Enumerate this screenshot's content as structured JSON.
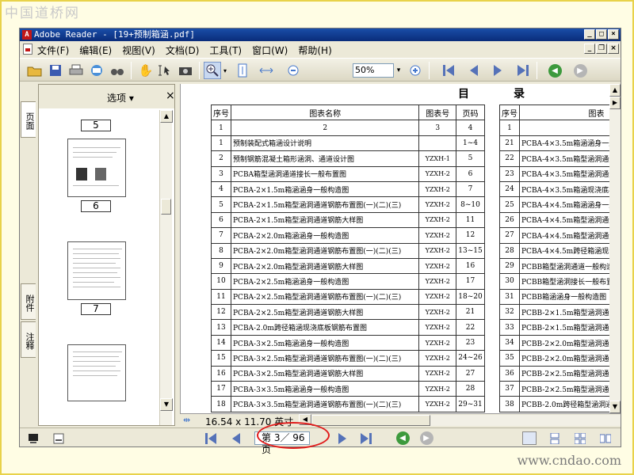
{
  "watermarks": {
    "top": "中国道桥网",
    "bottom": "www.cndao.com"
  },
  "window": {
    "title": "Adobe Reader - [19+预制箱涵.pdf]"
  },
  "menu": [
    "文件(F)",
    "编辑(E)",
    "视图(V)",
    "文档(D)",
    "工具(T)",
    "窗口(W)",
    "帮助(H)"
  ],
  "toolbar": {
    "zoom_value": "50%"
  },
  "side_tabs": [
    "页面",
    "附件",
    "注释"
  ],
  "panel": {
    "options_label": "选项 ▾",
    "thumbnails": [
      {
        "page": "5"
      },
      {
        "page": "6"
      },
      {
        "page": "7"
      }
    ]
  },
  "document": {
    "title_left": "目",
    "title_right": "录",
    "headers": [
      "序号",
      "图表名称",
      "图表号",
      "页码"
    ],
    "number_row": [
      "1",
      "2",
      "3",
      "4"
    ],
    "left_rows": [
      [
        "1",
        "预制装配式箱涵设计说明",
        "",
        "1~4"
      ],
      [
        "2",
        "预制钢筋混凝土箱形涵洞、通道设计图",
        "YZXH-1",
        "5"
      ],
      [
        "3",
        "PCBA箱型涵洞通道接长一般布置图",
        "YZXH-2",
        "6"
      ],
      [
        "4",
        "PCBA-2×1.5m箱涵涵身一般构造图",
        "YZXH-2",
        "7"
      ],
      [
        "5",
        "PCBA-2×1.5m箱型涵洞通道钢筋布置图(一)(二)(三)",
        "YZXH-2",
        "8~10"
      ],
      [
        "6",
        "PCBA-2×1.5m箱型涵洞通道钢筋大样图",
        "YZXH-2",
        "11"
      ],
      [
        "7",
        "PCBA-2×2.0m箱涵涵身一般构造图",
        "YZXH-2",
        "12"
      ],
      [
        "8",
        "PCBA-2×2.0m箱型涵洞通道钢筋布置图(一)(二)(三)",
        "YZXH-2",
        "13~15"
      ],
      [
        "9",
        "PCBA-2×2.0m箱型涵洞通道钢筋大样图",
        "YZXH-2",
        "16"
      ],
      [
        "10",
        "PCBA-2×2.5m箱涵涵身一般构造图",
        "YZXH-2",
        "17"
      ],
      [
        "11",
        "PCBA-2×2.5m箱型涵洞通道钢筋布置图(一)(二)(三)",
        "YZXH-2",
        "18~20"
      ],
      [
        "12",
        "PCBA-2×2.5m箱型涵洞通道钢筋大样图",
        "YZXH-2",
        "21"
      ],
      [
        "13",
        "PCBA-2.0m跨径箱涵现浇底板钢筋布置图",
        "YZXH-2",
        "22"
      ],
      [
        "14",
        "PCBA-3×2.5m箱涵涵身一般构造图",
        "YZXH-2",
        "23"
      ],
      [
        "15",
        "PCBA-3×2.5m箱型涵洞通道钢筋布置图(一)(二)(三)",
        "YZXH-2",
        "24~26"
      ],
      [
        "16",
        "PCBA-3×2.5m箱型涵洞通道钢筋大样图",
        "YZXH-2",
        "27"
      ],
      [
        "17",
        "PCBA-3×3.5m箱涵涵身一般构造图",
        "YZXH-2",
        "28"
      ],
      [
        "18",
        "PCBA-3×3.5m箱型涵洞通道钢筋布置图(一)(二)(三)",
        "YZXH-2",
        "29~31"
      ]
    ],
    "right_headers": [
      "序号",
      "图表"
    ],
    "right_number_row": [
      "1",
      ""
    ],
    "right_rows": [
      [
        "21",
        "PCBA-4×3.5m箱涵涵身一般构造"
      ],
      [
        "22",
        "PCBA-4×3.5m箱型涵洞通道钢筋"
      ],
      [
        "23",
        "PCBA-4×3.5m箱型涵洞通道钢筋"
      ],
      [
        "24",
        "PCBA-4×3.5m箱涵现浇底板钢筋"
      ],
      [
        "25",
        "PCBA-4×4.5m箱涵涵身一般构造"
      ],
      [
        "26",
        "PCBA-4×4.5m箱型涵洞通道钢筋"
      ],
      [
        "27",
        "PCBA-4×4.5m箱型涵洞通道钢筋"
      ],
      [
        "28",
        "PCBA-4×4.5m跨径箱涵现浇底板"
      ],
      [
        "29",
        "PCBB箱型涵洞通道一般构造图"
      ],
      [
        "30",
        "PCBB箱型涵洞接长一般布置图"
      ],
      [
        "31",
        "PCBB箱涵涵身一般构造图"
      ],
      [
        "32",
        "PCBB-2×1.5m箱型涵洞通道钢筋"
      ],
      [
        "33",
        "PCBB-2×1.5m箱型涵洞通道钢筋"
      ],
      [
        "34",
        "PCBB-2×2.0m箱型涵洞通道钢筋"
      ],
      [
        "35",
        "PCBB-2×2.0m箱型涵洞通道钢筋"
      ],
      [
        "36",
        "PCBB-2×2.5m箱型涵洞通道钢筋"
      ],
      [
        "37",
        "PCBB-2×2.5m箱型涵洞通道钢筋"
      ],
      [
        "38",
        "PCBB-2.0m跨径箱型涵洞通道现浇"
      ]
    ]
  },
  "pagesize": "16.54 x 11.70 英寸",
  "status": {
    "page_field": "第 3／ 96 页"
  },
  "colors": {
    "accent_red": "#e01b1b",
    "title_blue": "#1a4ea8",
    "nav_blue": "#5572b8",
    "go_green": "#3d9a3d"
  }
}
